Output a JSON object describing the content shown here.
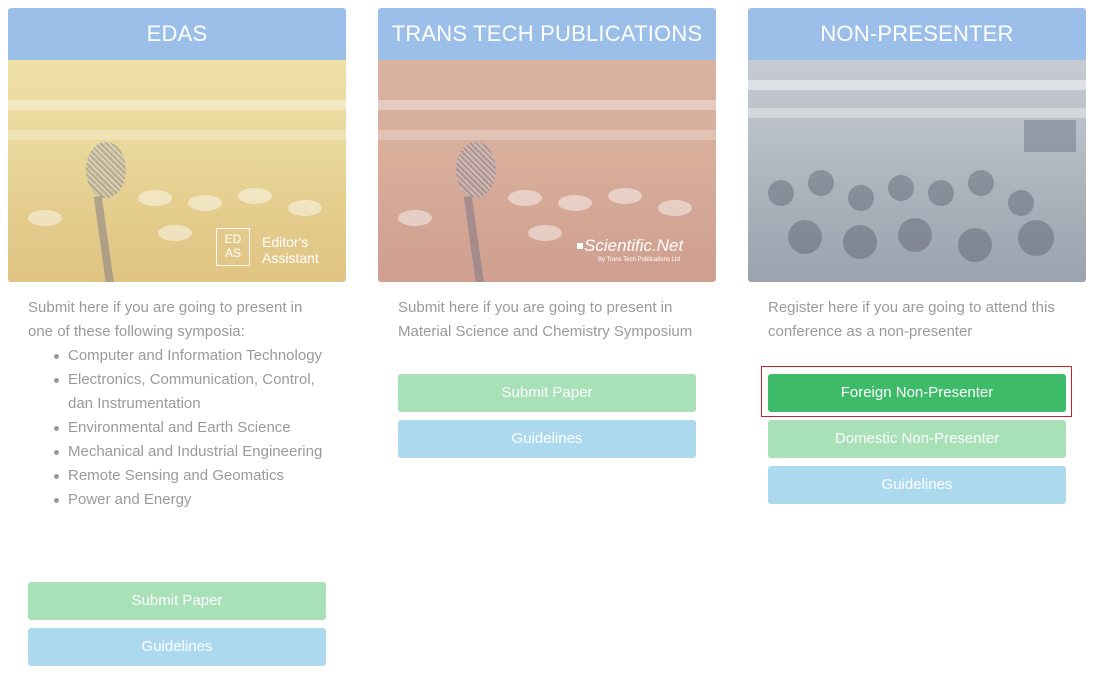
{
  "cards": [
    {
      "title": "EDAS",
      "logo": {
        "mark_line1": "ED",
        "mark_line2": "AS",
        "text_line1": "Editor's",
        "text_line2": "Assistant"
      },
      "description": "Submit here if you are going to present in one of these following symposia:",
      "symposia": [
        "Computer and Information Technology",
        "Electronics, Communication, Control, dan Instrumentation",
        "Environmental and Earth Science",
        "Mechanical and Industrial Engineering",
        "Remote Sensing and Geomatics",
        "Power and Energy"
      ],
      "buttons": {
        "submit": "Submit Paper",
        "guidelines": "Guidelines"
      }
    },
    {
      "title": "TRANS TECH PUBLICATIONS",
      "logo": {
        "name": "Scientific.Net",
        "sub": "By Trans Tech Publications Ltd"
      },
      "description": "Submit here if you are going to present in Material Science and Chemistry Symposium",
      "buttons": {
        "submit": "Submit Paper",
        "guidelines": "Guidelines"
      }
    },
    {
      "title": "NON-PRESENTER",
      "description": "Register here if you are going to attend this conference as a non-presenter",
      "buttons": {
        "foreign": "Foreign Non-Presenter",
        "domestic": "Domestic Non-Presenter",
        "guidelines": "Guidelines"
      }
    }
  ],
  "colors": {
    "header": "#9bbfe9",
    "green_light": "#a8e0b8",
    "green_strong": "#3dbb68",
    "blue_light": "#acd9ee",
    "highlight_border": "#c8232c",
    "text_muted": "#9a9a9a"
  },
  "icons": [
    "microphone-image",
    "edas-logo",
    "scientific-net-logo",
    "conference-audience-image"
  ]
}
